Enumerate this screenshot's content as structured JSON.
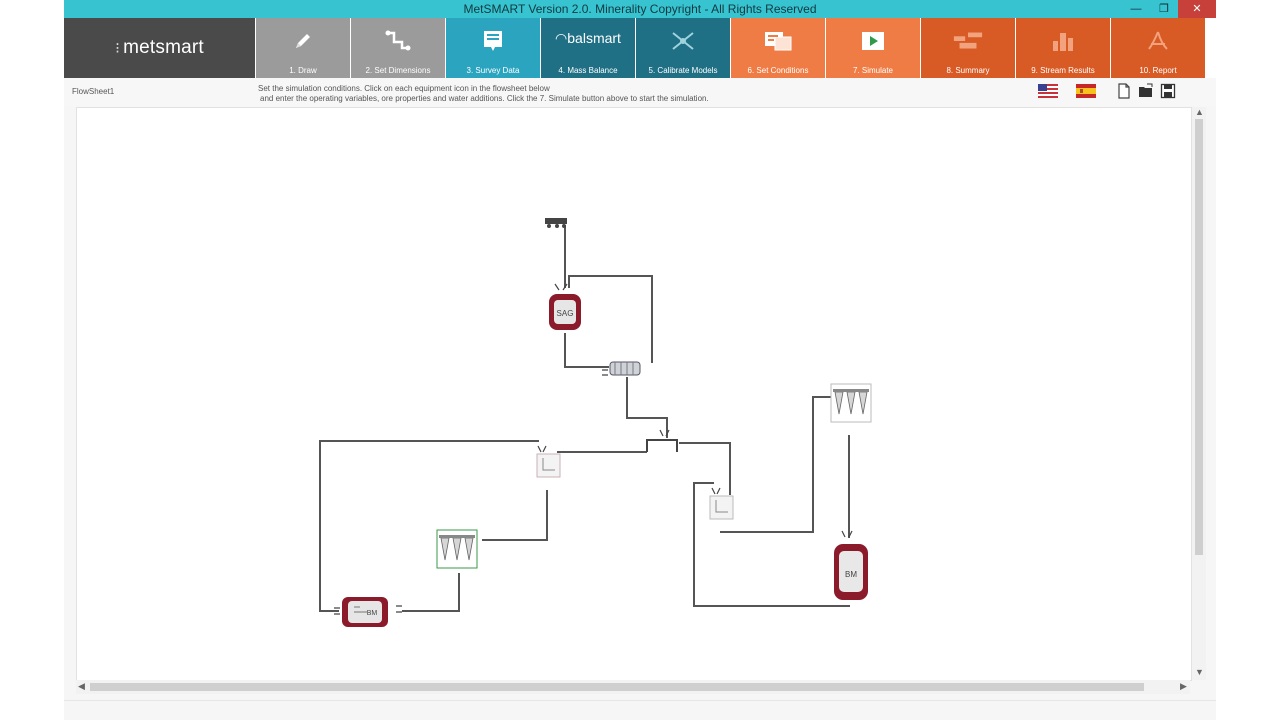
{
  "window": {
    "title": "MetSMART Version 2.0. Minerality Copyright - All Rights Reserved",
    "controls": {
      "minimize": "—",
      "restore": "❐",
      "close": "✕"
    }
  },
  "logo": {
    "text": "metsmart"
  },
  "ribbon": {
    "tiles": [
      {
        "label": "1. Draw",
        "color": "#9b9b9b",
        "icon": "pencil-icon"
      },
      {
        "label": "2. Set Dimensions",
        "color": "#9b9b9b",
        "icon": "dimensions-icon"
      },
      {
        "label": "3. Survey Data",
        "color": "#2aa4bf",
        "icon": "survey-data-icon"
      },
      {
        "label": "4. Mass Balance",
        "color": "#1f6f85",
        "icon": "balsmart-logo",
        "word": "balsmart"
      },
      {
        "label": "5. Calibrate Models",
        "color": "#1f6f85",
        "icon": "calibrate-icon"
      },
      {
        "label": "6. Set Conditions",
        "color": "#f07c45",
        "icon": "set-conditions-icon"
      },
      {
        "label": "7. Simulate",
        "color": "#f07c45",
        "icon": "play-icon"
      },
      {
        "label": "8. Summary",
        "color": "#d85a24",
        "icon": "summary-icon"
      },
      {
        "label": "9. Stream Results",
        "color": "#d85a24",
        "icon": "stream-results-icon"
      },
      {
        "label": "10. Report",
        "color": "#d85a24",
        "icon": "pdf-report-icon"
      }
    ],
    "active_index": 5
  },
  "infobar": {
    "flowsheet_name": "FlowSheet1",
    "instructions_line1": "Set the simulation conditions. Click on each equipment icon in the flowsheet below",
    "instructions_line2": "and enter the operating variables, ore properties and water additions. Click the 7. Simulate button above to start the simulation.",
    "flags": [
      "us-flag-icon",
      "spain-flag-icon"
    ],
    "tools": [
      "new-file-icon",
      "open-folder-icon",
      "save-icon"
    ]
  },
  "flowsheet": {
    "equipment": [
      {
        "name": "feed-conveyor",
        "label": ""
      },
      {
        "name": "sag-mill",
        "label": "SAG"
      },
      {
        "name": "trommel-screen",
        "label": ""
      },
      {
        "name": "splitter",
        "label": ""
      },
      {
        "name": "pump-box-left",
        "label": ""
      },
      {
        "name": "pump-box-right",
        "label": ""
      },
      {
        "name": "cyclone-cluster-left",
        "label": ""
      },
      {
        "name": "cyclone-cluster-right",
        "label": ""
      },
      {
        "name": "ball-mill",
        "label": "BM"
      },
      {
        "name": "vertical-mill",
        "label": "BM"
      }
    ]
  },
  "colors": {
    "titlebar": "#38c3d0",
    "accent_active": "#f0a030",
    "mill_red": "#8b1a2b",
    "pipe": "#555555"
  }
}
